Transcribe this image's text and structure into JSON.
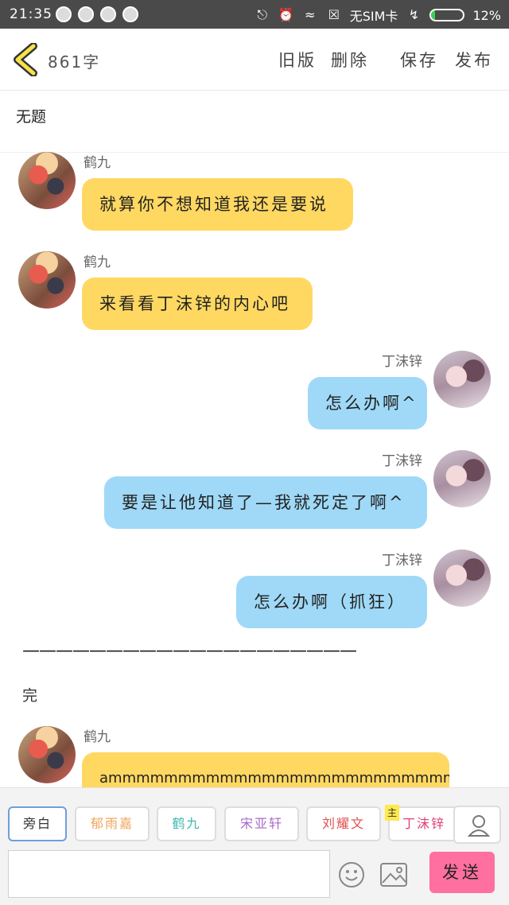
{
  "statusbar": {
    "time": "21:35",
    "carrier": "无SIM卡",
    "battery_percent": 12,
    "battery_label": "12%"
  },
  "topbar": {
    "word_count": "861字",
    "actions": [
      "旧版",
      "删除",
      "保存",
      "发布"
    ]
  },
  "story": {
    "title": "无题"
  },
  "messages": [
    {
      "sender": "鹤九",
      "text": "就算你不想知道我还是要说"
    },
    {
      "sender": "鹤九",
      "text": "来看看丁沫锌的内心吧"
    },
    {
      "sender": "丁沫锌",
      "text": "怎么办啊^"
    },
    {
      "sender": "丁沫锌",
      "text": "要是让他知道了—我就死定了啊^"
    },
    {
      "sender": "丁沫锌",
      "text": "怎么办啊（抓狂）"
    },
    {
      "sender": "鹤九",
      "text": "ammmmmmmmmmmmmmmmmmmmmmmmmmmmmmmmmmmmmm"
    }
  ],
  "narration": {
    "divider": "————————————————————",
    "end": "完"
  },
  "roles": [
    {
      "label": "旁白",
      "color": "#333333"
    },
    {
      "label": "郁雨嘉",
      "color": "#f0a45a"
    },
    {
      "label": "鹤九",
      "color": "#3fb8b0"
    },
    {
      "label": "宋亚轩",
      "color": "#a86cc8"
    },
    {
      "label": "刘耀文",
      "color": "#e05050"
    },
    {
      "label": "丁沫锌",
      "color": "#e0407a"
    }
  ],
  "host_badge": "主",
  "composer": {
    "placeholder": "",
    "send_label": "发送"
  }
}
